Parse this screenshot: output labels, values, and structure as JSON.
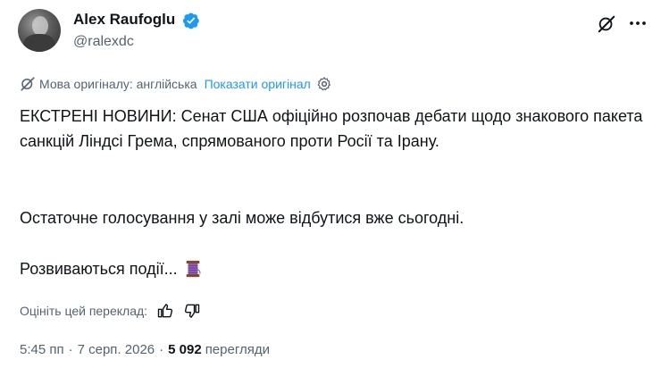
{
  "author": {
    "name": "Alex Raufoglu",
    "handle": "@ralexdc",
    "verified": true
  },
  "translation": {
    "source_language_label": "Мова оригіналу: англійська",
    "show_original_label": "Показати оригінал"
  },
  "tweet": {
    "paragraphs": [
      "ЕКСТРЕНІ НОВИНИ: Сенат США офіційно розпочав дебати щодо знакового пакета санкцій Ліндсі Грема, спрямованого проти Росії та Ірану.",
      "Остаточне голосування у залі може відбутися вже сьогодні.",
      "Розвиваються події..."
    ],
    "emoji_icon": "thread-spool-icon"
  },
  "rating": {
    "label": "Оцініть цей переклад:"
  },
  "meta": {
    "time": "5:45 пп",
    "separator": "·",
    "date": "7 серп. 2026",
    "views_count": "5 092",
    "views_label": "перегляди"
  },
  "colors": {
    "text": "#0f1419",
    "secondary": "#536471",
    "link": "#1d9bf0",
    "verified": "#1d9bf0"
  }
}
